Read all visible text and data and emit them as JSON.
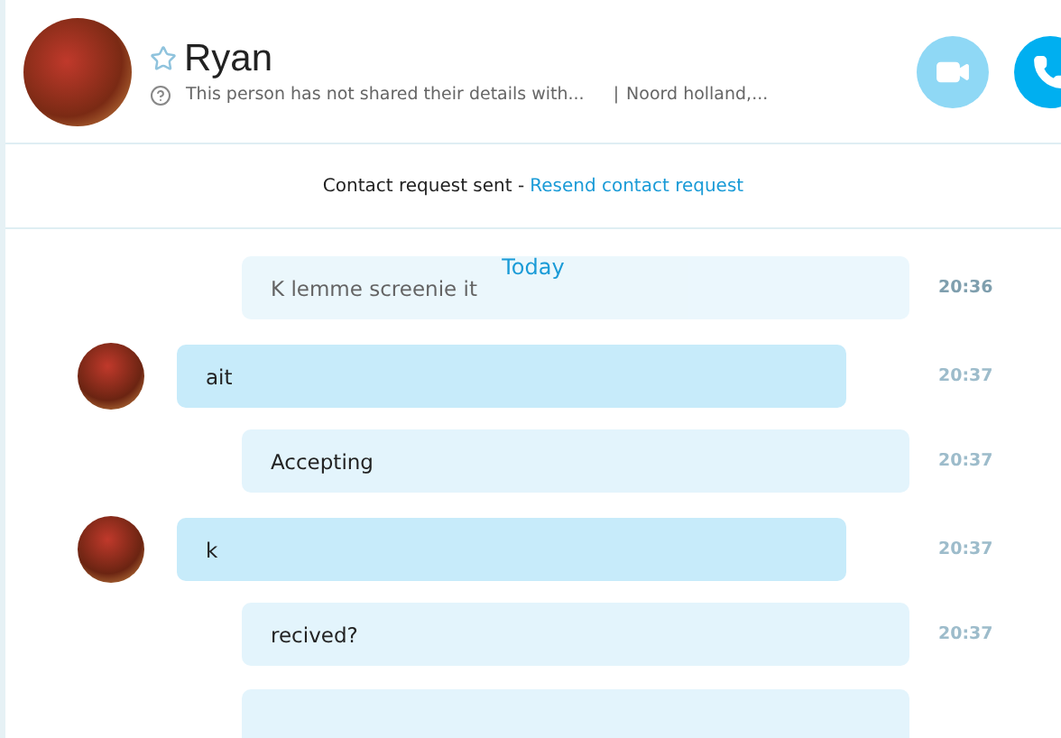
{
  "contact": {
    "name": "Ryan",
    "favorite": false,
    "details": "This person has not shared their details with...",
    "separator": "|",
    "location": "Noord holland,..."
  },
  "notice": {
    "text": "Contact request sent - ",
    "link": "Resend contact request"
  },
  "date_divider": "Today",
  "messages": [
    {
      "kind": "outgoing",
      "text": "K lemme screenie it",
      "time": "20:36",
      "faded": true
    },
    {
      "kind": "incoming",
      "text": "ait",
      "time": "20:37",
      "faded": false
    },
    {
      "kind": "outgoing",
      "text": "Accepting",
      "time": "20:37",
      "faded": false
    },
    {
      "kind": "incoming",
      "text": "k",
      "time": "20:37",
      "faded": false
    },
    {
      "kind": "outgoing",
      "text": "recived?",
      "time": "20:37",
      "faded": false
    }
  ]
}
